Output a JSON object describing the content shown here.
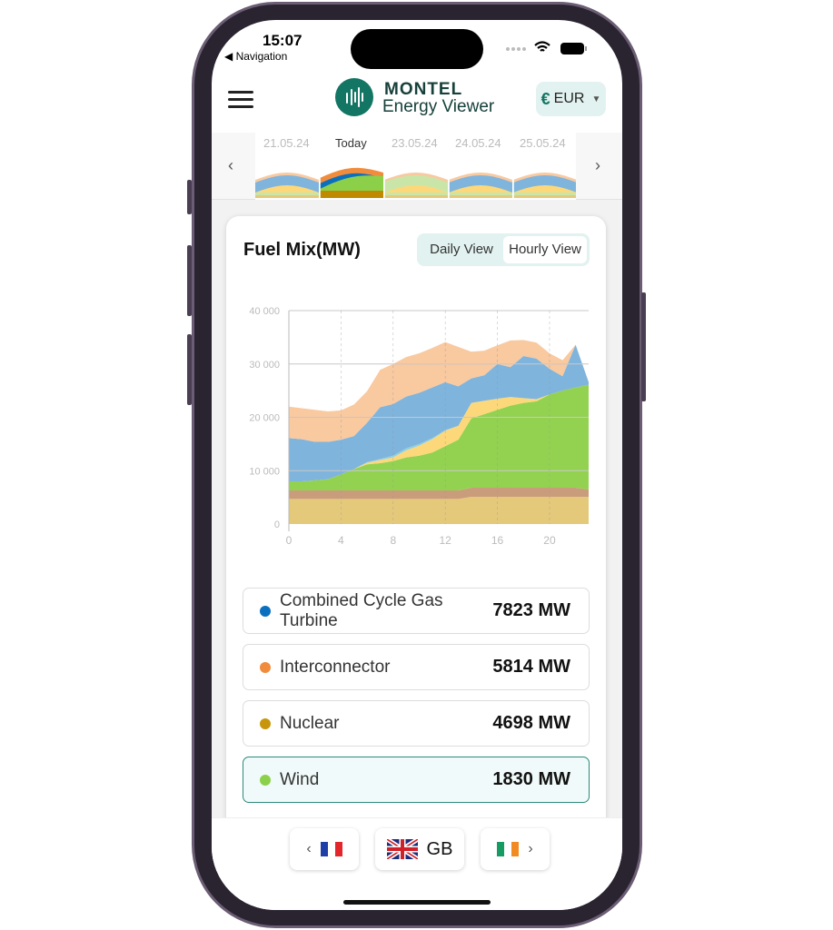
{
  "status": {
    "time": "15:07",
    "back": "◀ Navigation"
  },
  "header": {
    "brand_top": "MONTEL",
    "brand_bottom": "Energy Viewer",
    "currency_symbol": "€",
    "currency": "EUR",
    "brand_color": "#137563"
  },
  "date_strip": {
    "days": [
      "21.05.24",
      "Today",
      "23.05.24",
      "24.05.24",
      "25.05.24"
    ],
    "prev": "‹",
    "next": "›"
  },
  "panel": {
    "title": "Fuel Mix(MW)",
    "views": [
      "Daily View",
      "Hourly View"
    ],
    "active_view": "Hourly View"
  },
  "chart_data": {
    "type": "area",
    "stacked": true,
    "x": [
      0,
      1,
      2,
      3,
      4,
      5,
      6,
      7,
      8,
      9,
      10,
      11,
      12,
      13,
      14,
      15,
      16,
      17,
      18,
      19,
      20,
      21,
      22,
      23
    ],
    "xticks": [
      "0",
      "4",
      "8",
      "12",
      "16",
      "20"
    ],
    "yticks": [
      "0",
      "10 000",
      "20 000",
      "30 000",
      "40 000"
    ],
    "ylim": [
      0,
      40000
    ],
    "xlim": [
      0,
      23
    ],
    "grid": true,
    "series": [
      {
        "color": "#e5c97a",
        "values": [
          4700,
          4700,
          4700,
          4700,
          4700,
          4700,
          4700,
          4700,
          4700,
          4700,
          4700,
          4700,
          4700,
          4700,
          5100,
          5100,
          5100,
          5100,
          5100,
          5100,
          5100,
          5100,
          5100,
          5100
        ]
      },
      {
        "color": "#c99d7c",
        "values": [
          1600,
          1600,
          1600,
          1600,
          1600,
          1600,
          1600,
          1600,
          1600,
          1600,
          1600,
          1600,
          1600,
          1600,
          1700,
          1700,
          1700,
          1700,
          1700,
          1700,
          1700,
          1700,
          1700,
          1400
        ]
      },
      {
        "color": "#93d250",
        "values": [
          1700,
          1700,
          1900,
          2100,
          3000,
          4000,
          4900,
          5100,
          5500,
          6200,
          6500,
          7100,
          8300,
          9500,
          13000,
          13800,
          14600,
          15400,
          15900,
          16200,
          17500,
          18200,
          18800,
          19600
        ]
      },
      {
        "color": "#fdd87a",
        "values": [
          0,
          0,
          0,
          0,
          0,
          0,
          300,
          600,
          700,
          1300,
          1900,
          2500,
          2900,
          2600,
          2900,
          2500,
          2100,
          1600,
          900,
          400,
          0,
          0,
          0,
          0
        ]
      },
      {
        "color": "#8fd0e0",
        "values": [
          0,
          0,
          0,
          0,
          0,
          0,
          100,
          200,
          300,
          400,
          300,
          200,
          100,
          0,
          0,
          0,
          0,
          0,
          0,
          0,
          0,
          0,
          0,
          0
        ]
      },
      {
        "color": "#7fb4dd",
        "values": [
          8100,
          7900,
          7200,
          7000,
          6500,
          6200,
          7400,
          9700,
          9700,
          9700,
          9600,
          9500,
          9000,
          7400,
          4600,
          4800,
          6500,
          5600,
          7900,
          7600,
          4800,
          2700,
          8000,
          500
        ]
      },
      {
        "color": "#f9c9a0",
        "values": [
          5900,
          5800,
          6000,
          5700,
          5500,
          5900,
          5900,
          7000,
          7500,
          7400,
          7400,
          7400,
          7500,
          7400,
          5000,
          4600,
          3500,
          5000,
          3000,
          3000,
          2900,
          3000,
          0,
          0
        ]
      }
    ]
  },
  "legend": [
    {
      "name": "Combined Cycle Gas Turbine",
      "value": "7823 MW",
      "color": "#0a6fbf"
    },
    {
      "name": "Interconnector",
      "value": "5814 MW",
      "color": "#f08c3c"
    },
    {
      "name": "Nuclear",
      "value": "4698 MW",
      "color": "#c8960a"
    },
    {
      "name": "Wind",
      "value": "1830 MW",
      "color": "#8cd04a",
      "selected": true
    }
  ],
  "countries": {
    "prev_flag": "france-flag",
    "current": "GB",
    "next_flag": "ireland-flag"
  }
}
